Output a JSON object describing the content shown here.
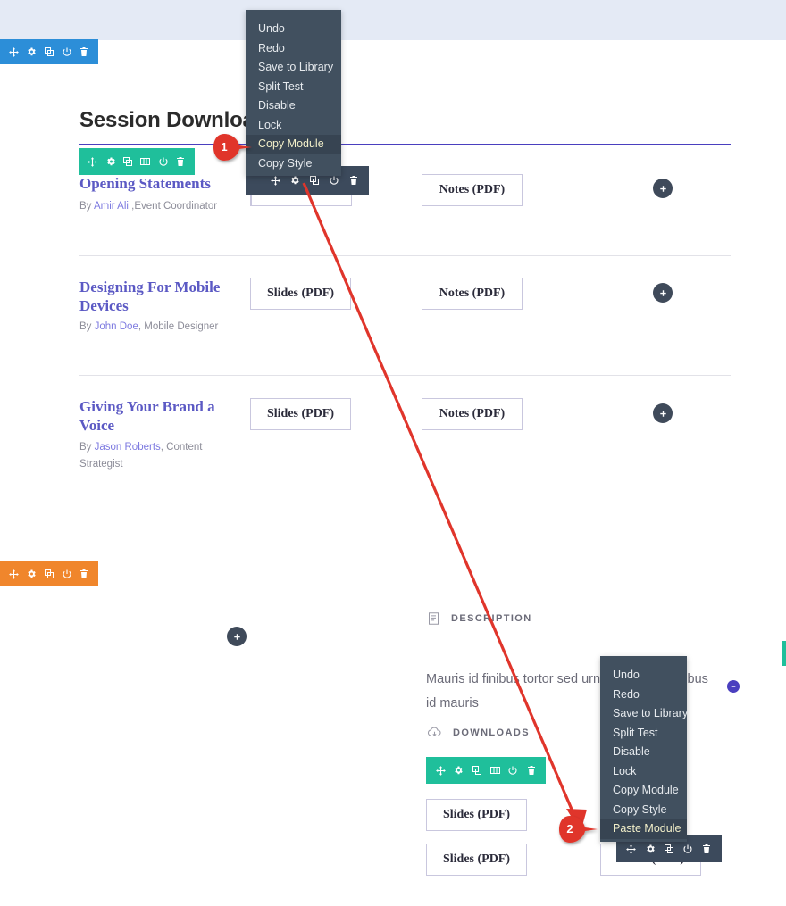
{
  "page": {
    "title": "Session Downloads"
  },
  "toolbars": {
    "section_blue": {
      "color": "#2c8ed8",
      "icons": [
        "move-icon",
        "gear-icon",
        "duplicate-icon",
        "power-icon",
        "trash-icon"
      ]
    },
    "section_orange": {
      "color": "#f0862c",
      "icons": [
        "move-icon",
        "gear-icon",
        "duplicate-icon",
        "power-icon",
        "trash-icon"
      ]
    },
    "row_teal_top": {
      "color": "#1fbf9b",
      "icons": [
        "move-icon",
        "gear-icon",
        "duplicate-icon",
        "columns-icon",
        "power-icon",
        "trash-icon"
      ]
    },
    "row_teal_bottom": {
      "color": "#1fbf9b",
      "icons": [
        "move-icon",
        "gear-icon",
        "duplicate-icon",
        "columns-icon",
        "power-icon",
        "trash-icon"
      ]
    },
    "module_dark_top": {
      "color": "#3c4a5c",
      "icons": [
        "move-icon",
        "gear-icon",
        "duplicate-icon",
        "power-icon",
        "trash-icon"
      ]
    },
    "module_dark_bottom": {
      "color": "#3c4a5c",
      "icons": [
        "move-icon",
        "gear-icon",
        "duplicate-icon",
        "power-icon",
        "trash-icon"
      ]
    }
  },
  "context_menu_top": {
    "items": [
      {
        "label": "Undo",
        "highlight": false
      },
      {
        "label": "Redo",
        "highlight": false
      },
      {
        "label": "Save to Library",
        "highlight": false
      },
      {
        "label": "Split Test",
        "highlight": false
      },
      {
        "label": "Disable",
        "highlight": false
      },
      {
        "label": "Lock",
        "highlight": false
      },
      {
        "label": "Copy Module",
        "highlight": true
      },
      {
        "label": "Copy Style",
        "highlight": false
      }
    ]
  },
  "context_menu_bottom": {
    "items": [
      {
        "label": "Undo",
        "highlight": false
      },
      {
        "label": "Redo",
        "highlight": false
      },
      {
        "label": "Save to Library",
        "highlight": false
      },
      {
        "label": "Split Test",
        "highlight": false
      },
      {
        "label": "Disable",
        "highlight": false
      },
      {
        "label": "Lock",
        "highlight": false
      },
      {
        "label": "Copy Module",
        "highlight": false
      },
      {
        "label": "Copy Style",
        "highlight": false
      },
      {
        "label": "Paste Module",
        "highlight": true
      }
    ]
  },
  "sessions": [
    {
      "title": "Opening Statements",
      "by_prefix": "By ",
      "author": "Amir Ali",
      "role": " ,Event Coordinator",
      "slides_label": "Slides (PDF)",
      "notes_label": "Notes (PDF)"
    },
    {
      "title": "Designing For Mobile Devices",
      "by_prefix": "By ",
      "author": "John Doe",
      "role": ", Mobile Designer",
      "slides_label": "Slides (PDF)",
      "notes_label": "Notes (PDF)"
    },
    {
      "title": "Giving Your Brand a Voice",
      "by_prefix": "By ",
      "author": "Jason Roberts",
      "role": ", Content Strategist",
      "slides_label": "Slides (PDF)",
      "notes_label": "Notes (PDF)"
    }
  ],
  "lower_module": {
    "description_label": "DESCRIPTION",
    "description_text": "Mauris id finibus tortor sed urna tristique a finibus id mauris",
    "downloads_label": "DOWNLOADS",
    "slides_1": "Slides (PDF)",
    "slides_2": "Slides (PDF)",
    "slides_3": "Slides (PDF)"
  },
  "markers": [
    {
      "number": "1",
      "color": "#e8392b"
    },
    {
      "number": "2",
      "color": "#e8392b"
    }
  ],
  "colors": {
    "accent_purple": "#4a3fbf",
    "teal": "#1fbf9b",
    "orange": "#f0862c",
    "blue": "#2c8ed8",
    "dark_slate": "#41505f",
    "marker_red": "#e8392b"
  }
}
